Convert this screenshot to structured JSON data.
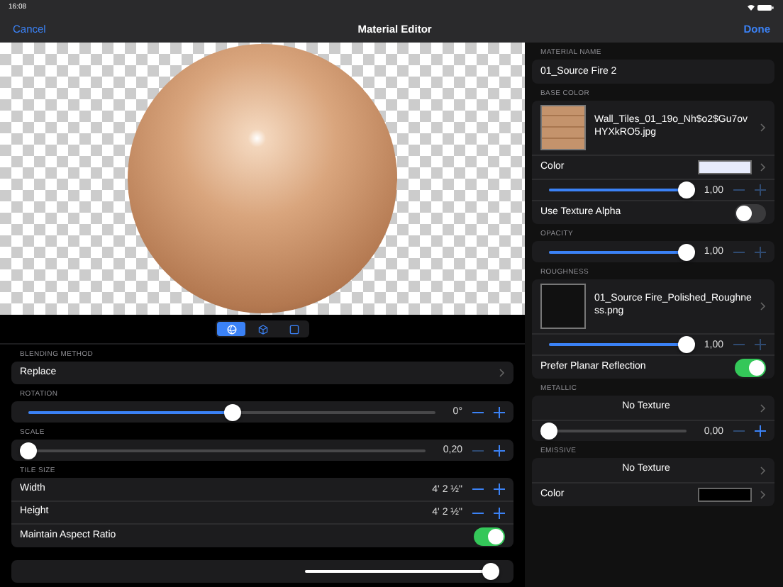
{
  "status_bar": {
    "time": "16:08"
  },
  "nav": {
    "cancel": "Cancel",
    "title": "Material Editor",
    "done": "Done"
  },
  "view_modes": [
    {
      "kind": "sphere",
      "selected": true
    },
    {
      "kind": "cube",
      "selected": false
    },
    {
      "kind": "plane",
      "selected": false
    }
  ],
  "left_sections": [
    {
      "header": "BLENDING METHOD",
      "rows": [
        {
          "kind": "link",
          "label": "Replace"
        }
      ]
    },
    {
      "header": "ROTATION",
      "rows": [
        {
          "kind": "slider",
          "level": 0.5,
          "reading": "0°",
          "minus_disabled": false,
          "plus_disabled": false
        }
      ]
    },
    {
      "header": "SCALE",
      "rows": [
        {
          "kind": "slider",
          "level": 0,
          "reading": "0,20",
          "minus_disabled": true,
          "plus_disabled": false
        }
      ]
    },
    {
      "header": "TILE SIZE",
      "rows": [
        {
          "kind": "stepper",
          "label": "Width",
          "reading": "4' 2 ½\"",
          "minus_disabled": false,
          "plus_disabled": false
        },
        {
          "kind": "stepper",
          "label": "Height",
          "reading": "4' 2 ½\"",
          "minus_disabled": false,
          "plus_disabled": false
        },
        {
          "kind": "toggle",
          "label": "Maintain Aspect Ratio",
          "on": true
        }
      ]
    },
    {
      "rows": [
        {
          "kind": "bare_slider",
          "level": 0.97
        }
      ]
    }
  ],
  "right_sections": [
    {
      "header": "MATERIAL NAME",
      "rows": [
        {
          "kind": "text",
          "label": "01_Source Fire 2"
        }
      ]
    },
    {
      "header": "BASE COLOR",
      "rows": [
        {
          "kind": "texture",
          "preview": true,
          "label": "Wall_Tiles_01_19o_Nh$o2$Gu7ovHYXkRO5.jpg"
        },
        {
          "kind": "color",
          "label": "Color",
          "color": "#e8ecfc"
        },
        {
          "kind": "slider",
          "level": 1,
          "reading": "1,00",
          "minus_disabled": true,
          "plus_disabled": true
        },
        {
          "kind": "toggle",
          "label": "Use Texture Alpha",
          "on": false
        }
      ]
    },
    {
      "header": "OPACITY",
      "rows": [
        {
          "kind": "slider",
          "level": 1,
          "reading": "1,00",
          "minus_disabled": true,
          "plus_disabled": true
        }
      ]
    },
    {
      "header": "ROUGHNESS",
      "rows": [
        {
          "kind": "texture",
          "preview": false,
          "label": "01_Source Fire_Polished_Roughness.png"
        },
        {
          "kind": "slider",
          "level": 1,
          "reading": "1,00",
          "minus_disabled": true,
          "plus_disabled": true
        },
        {
          "kind": "toggle",
          "label": "Prefer Planar Reflection",
          "on": true
        }
      ]
    },
    {
      "header": "METALLIC",
      "rows": [
        {
          "kind": "centered_link",
          "label": "No Texture"
        },
        {
          "kind": "slider",
          "level": 0,
          "reading": "0,00",
          "minus_disabled": true,
          "plus_disabled": false
        }
      ]
    },
    {
      "header": "EMISSIVE",
      "rows": [
        {
          "kind": "centered_link",
          "label": "No Texture"
        },
        {
          "kind": "color",
          "label": "Color",
          "color": "#000000"
        }
      ]
    }
  ]
}
